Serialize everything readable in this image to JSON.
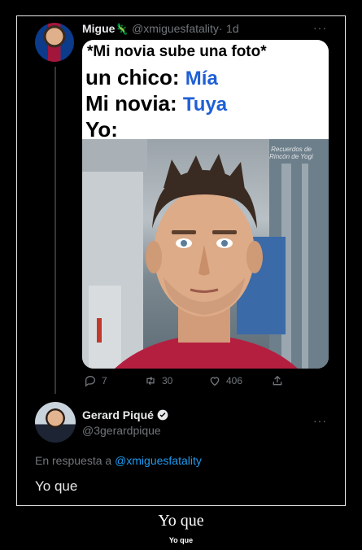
{
  "tweet": {
    "display_name": "Migue",
    "emoji": "🦎",
    "handle": "@xmiguesfatality",
    "separator": "·",
    "time": "1d",
    "more": "···",
    "meme": {
      "line1": "*Mi novia sube una foto*",
      "line2_label": "un chico:",
      "line2_value": "Mía",
      "line3_label": "Mi novia:",
      "line3_value": "Tuya",
      "line4_label": "Yo:",
      "watermark": "Recuerdos de Rincón de Yogi"
    },
    "stats": {
      "replies": "7",
      "retweets": "30",
      "likes": "406"
    }
  },
  "reply": {
    "display_name": "Gerard Piqué",
    "handle": "@3gerardpique",
    "more": "···",
    "replying_prefix": "En respuesta a",
    "replying_handle": "@xmiguesfatality",
    "text": "Yo que"
  },
  "caption": {
    "title": "Yo que",
    "subtitle": "Yo que"
  },
  "colors": {
    "background": "#000000",
    "link": "#1d9bf0",
    "meme_blue": "#1f5fd6",
    "muted": "#71767b"
  }
}
